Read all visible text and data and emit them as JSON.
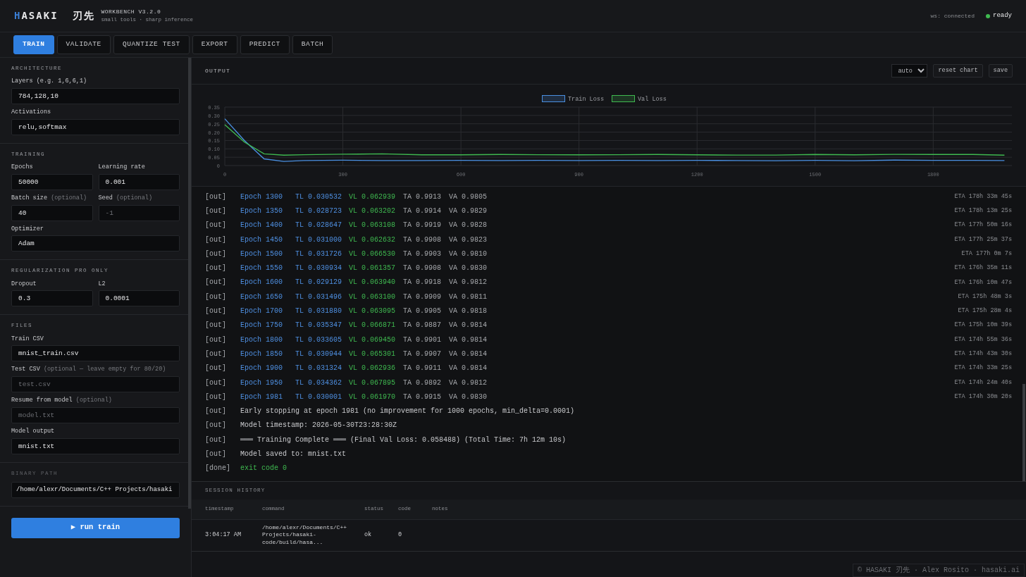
{
  "header": {
    "logo_first": "H",
    "logo_rest": "ASAKI",
    "logo_jp": "刃先",
    "product": "WORKBENCH V3.2.0",
    "tagline": "small tools · sharp inference",
    "ws": "ws: connected",
    "status": "ready"
  },
  "tabs": [
    {
      "label": "TRAIN",
      "selected": true
    },
    {
      "label": "VALIDATE",
      "selected": false
    },
    {
      "label": "QUANTIZE TEST",
      "selected": false
    },
    {
      "label": "EXPORT",
      "selected": false
    },
    {
      "label": "PREDICT",
      "selected": false
    },
    {
      "label": "BATCH",
      "selected": false
    }
  ],
  "sidebar": {
    "sections": [
      {
        "title": "ARCHITECTURE",
        "rows": [
          [
            {
              "kind": "input",
              "label": "Layers (e.g. 1,6,6,1)",
              "value": "784,128,10"
            }
          ],
          [
            {
              "kind": "input",
              "label": "Activations",
              "value": "relu,softmax"
            }
          ]
        ]
      },
      {
        "title": "TRAINING",
        "rows": [
          [
            {
              "kind": "input",
              "label": "Epochs",
              "value": "50000"
            },
            {
              "kind": "input",
              "label": "Learning rate",
              "value": "0.001"
            }
          ],
          [
            {
              "kind": "input",
              "label": "Batch size",
              "note": "(optional)",
              "value": "40"
            },
            {
              "kind": "input",
              "label": "Seed",
              "note": "(optional)",
              "placeholder": "-1"
            }
          ],
          [
            {
              "kind": "select",
              "label": "Optimizer",
              "value": "Adam"
            }
          ]
        ]
      },
      {
        "title": "REGULARIZATION PRO ONLY",
        "rows": [
          [
            {
              "kind": "input",
              "label": "Dropout",
              "value": "0.3"
            },
            {
              "kind": "input",
              "label": "L2",
              "value": "0.0001"
            }
          ]
        ]
      },
      {
        "title": "FILES",
        "rows": [
          [
            {
              "kind": "input",
              "label": "Train CSV",
              "value": "mnist_train.csv"
            }
          ],
          [
            {
              "kind": "input",
              "label": "Test CSV",
              "note": "(optional — leave empty for 80/20)",
              "placeholder": "test.csv"
            }
          ],
          [
            {
              "kind": "input",
              "label": "Resume from model",
              "note": "(optional)",
              "placeholder": "model.txt"
            }
          ],
          [
            {
              "kind": "input",
              "label": "Model output",
              "value": "mnist.txt"
            }
          ]
        ]
      },
      {
        "title": "BINARY PATH",
        "rows": [
          [
            {
              "kind": "input",
              "value": "/home/alexr/Documents/C++ Projects/hasaki"
            }
          ]
        ]
      }
    ],
    "run_button": "▶ run train"
  },
  "output": {
    "title": "OUTPUT",
    "mode": "auto",
    "buttons": [
      "reset chart",
      "save"
    ],
    "chart_data": {
      "type": "line",
      "x": [
        0,
        50,
        100,
        150,
        200,
        300,
        400,
        500,
        600,
        700,
        800,
        900,
        1000,
        1100,
        1200,
        1300,
        1400,
        1500,
        1600,
        1700,
        1800,
        1900,
        1981
      ],
      "series": [
        {
          "name": "Train Loss",
          "color": "#4a8fe0",
          "values": [
            0.28,
            0.15,
            0.04,
            0.025,
            0.03,
            0.032,
            0.03,
            0.03,
            0.031,
            0.03,
            0.031,
            0.03,
            0.031,
            0.03,
            0.031,
            0.03,
            0.029,
            0.031,
            0.029,
            0.033,
            0.031,
            0.031,
            0.03
          ]
        },
        {
          "name": "Val Loss",
          "color": "#3fb950",
          "values": [
            0.245,
            0.14,
            0.07,
            0.062,
            0.065,
            0.068,
            0.07,
            0.064,
            0.064,
            0.066,
            0.065,
            0.064,
            0.065,
            0.066,
            0.064,
            0.063,
            0.063,
            0.066,
            0.064,
            0.067,
            0.066,
            0.066,
            0.062
          ]
        }
      ],
      "xlim": [
        0,
        2000
      ],
      "ylim": [
        0,
        0.35
      ],
      "grid": true,
      "legend": true,
      "xticks": [
        0,
        300,
        600,
        900,
        1200,
        1500,
        1800
      ],
      "yticks": [
        0,
        {
          "value": 0.05,
          "label": "0.05"
        },
        {
          "value": 0.1,
          "label": "0.10"
        },
        {
          "value": 0.15,
          "label": "0.15"
        },
        {
          "value": 0.2,
          "label": "0.20"
        },
        {
          "value": 0.25,
          "label": "0.25"
        },
        {
          "value": 0.3,
          "label": "0.30"
        },
        {
          "value": 0.35,
          "label": "0.35"
        }
      ]
    },
    "log": [
      {
        "kind": "epoch",
        "tag": "[out]",
        "epoch": "Epoch 1300",
        "tl": "TL 0.030532",
        "vl": "VL 0.062939",
        "ta": "TA 0.9913",
        "va": "VA 0.9805",
        "eta": "ETA 178h 33m 45s"
      },
      {
        "kind": "epoch",
        "tag": "[out]",
        "epoch": "Epoch 1350",
        "tl": "TL 0.028723",
        "vl": "VL 0.063202",
        "ta": "TA 0.9914",
        "va": "VA 0.9829",
        "eta": "ETA 178h 13m 25s"
      },
      {
        "kind": "epoch",
        "tag": "[out]",
        "epoch": "Epoch 1400",
        "tl": "TL 0.028647",
        "vl": "VL 0.063108",
        "ta": "TA 0.9919",
        "va": "VA 0.9828",
        "eta": "ETA 177h 50m 16s"
      },
      {
        "kind": "epoch",
        "tag": "[out]",
        "epoch": "Epoch 1450",
        "tl": "TL 0.031000",
        "vl": "VL 0.062632",
        "ta": "TA 0.9908",
        "va": "VA 0.9823",
        "eta": "ETA 177h 25m 37s"
      },
      {
        "kind": "epoch",
        "tag": "[out]",
        "epoch": "Epoch 1500",
        "tl": "TL 0.031726",
        "vl": "VL 0.066530",
        "ta": "TA 0.9903",
        "va": "VA 0.9810",
        "eta": "ETA 177h 0m 7s"
      },
      {
        "kind": "epoch",
        "tag": "[out]",
        "epoch": "Epoch 1550",
        "tl": "TL 0.030934",
        "vl": "VL 0.061357",
        "ta": "TA 0.9908",
        "va": "VA 0.9830",
        "eta": "ETA 176h 35m 11s"
      },
      {
        "kind": "epoch",
        "tag": "[out]",
        "epoch": "Epoch 1600",
        "tl": "TL 0.029129",
        "vl": "VL 0.063940",
        "ta": "TA 0.9918",
        "va": "VA 0.9812",
        "eta": "ETA 176h 10m 47s"
      },
      {
        "kind": "epoch",
        "tag": "[out]",
        "epoch": "Epoch 1650",
        "tl": "TL 0.031496",
        "vl": "VL 0.063100",
        "ta": "TA 0.9909",
        "va": "VA 0.9811",
        "eta": "ETA 175h 48m 3s"
      },
      {
        "kind": "epoch",
        "tag": "[out]",
        "epoch": "Epoch 1700",
        "tl": "TL 0.031880",
        "vl": "VL 0.063095",
        "ta": "TA 0.9905",
        "va": "VA 0.9818",
        "eta": "ETA 175h 28m 4s"
      },
      {
        "kind": "epoch",
        "tag": "[out]",
        "epoch": "Epoch 1750",
        "tl": "TL 0.035347",
        "vl": "VL 0.066871",
        "ta": "TA 0.9887",
        "va": "VA 0.9814",
        "eta": "ETA 175h 10m 39s"
      },
      {
        "kind": "epoch",
        "tag": "[out]",
        "epoch": "Epoch 1800",
        "tl": "TL 0.033605",
        "vl": "VL 0.069450",
        "ta": "TA 0.9901",
        "va": "VA 0.9814",
        "eta": "ETA 174h 55m 36s"
      },
      {
        "kind": "epoch",
        "tag": "[out]",
        "epoch": "Epoch 1850",
        "tl": "TL 0.030944",
        "vl": "VL 0.065301",
        "ta": "TA 0.9907",
        "va": "VA 0.9814",
        "eta": "ETA 174h 43m 30s"
      },
      {
        "kind": "epoch",
        "tag": "[out]",
        "epoch": "Epoch 1900",
        "tl": "TL 0.031324",
        "vl": "VL 0.062936",
        "ta": "TA 0.9911",
        "va": "VA 0.9814",
        "eta": "ETA 174h 33m 25s"
      },
      {
        "kind": "epoch",
        "tag": "[out]",
        "epoch": "Epoch 1950",
        "tl": "TL 0.034362",
        "vl": "VL 0.067895",
        "ta": "TA 0.9892",
        "va": "VA 0.9812",
        "eta": "ETA 174h 24m 40s"
      },
      {
        "kind": "epoch",
        "tag": "[out]",
        "epoch": "Epoch 1981",
        "tl": "TL 0.030001",
        "vl": "VL 0.061970",
        "ta": "TA 0.9915",
        "va": "VA 0.9830",
        "eta": "ETA 174h 30m 20s"
      },
      {
        "kind": "message",
        "tag": "[out]",
        "text": "Early stopping at epoch 1981 (no improvement for 1000 epochs, min_delta=0.0001)"
      },
      {
        "kind": "message",
        "tag": "[out]",
        "text": "Model timestamp: 2026-05-30T23:28:30Z"
      },
      {
        "kind": "message",
        "tag": "[out]",
        "text": "═══ Training Complete ═══ (Final Val Loss: 0.058488) (Total Time: 7h 12m 10s)"
      },
      {
        "kind": "message",
        "tag": "[out]",
        "text": "Model saved to: mnist.txt"
      },
      {
        "kind": "done",
        "tag": "[done]",
        "text": "exit code 0"
      }
    ]
  },
  "history": {
    "title": "SESSION HISTORY",
    "columns": [
      "timestamp",
      "command",
      "status",
      "code",
      "notes"
    ],
    "rows": [
      {
        "timestamp": "3:04:17 AM",
        "command": "/home/alexr/Documents/C++ Projects/hasaki-code/build/hasa...",
        "status": "ok",
        "code": "0"
      }
    ]
  },
  "footer": "© HASAKI 刃先 · Alex Rosito · hasaki.ai"
}
